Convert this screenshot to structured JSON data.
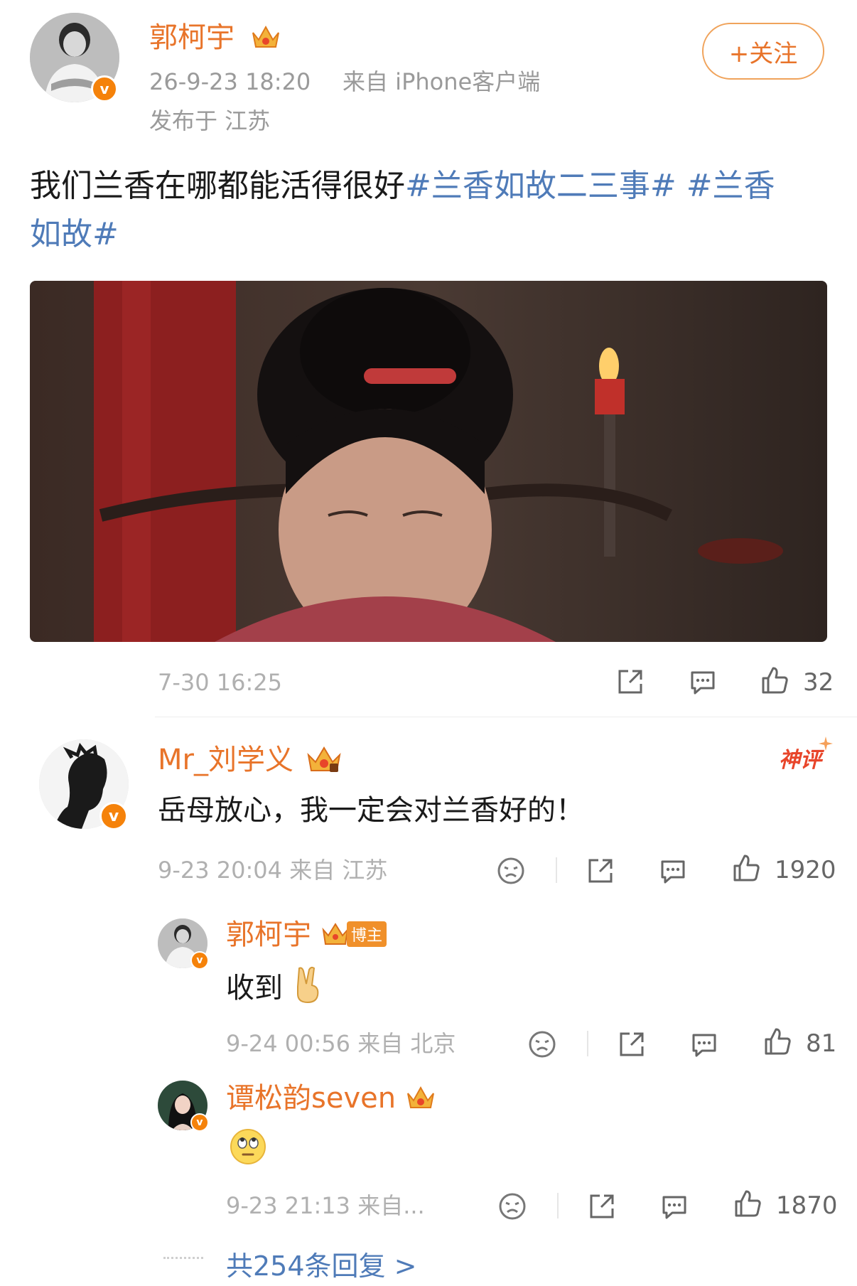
{
  "post": {
    "author": "郭柯宇",
    "time": "26-9-23 18:20",
    "source": "来自 iPhone客户端",
    "location": "发布于 江苏",
    "follow_label": "+关注",
    "text_prefix": "我们兰香在哪都能活得很好",
    "topic1": "#兰香如故二三事#",
    "topic2_part1": "#兰香",
    "topic2_part2": "如故#",
    "stamp": "7-30 16:25",
    "likes": "32"
  },
  "comments": [
    {
      "name": "Mr_刘学义",
      "badge": "神评",
      "text": "岳母放心，我一定会对兰香好的！",
      "meta": "9-23 20:04 来自 江苏",
      "likes": "1920"
    }
  ],
  "replies": [
    {
      "name": "郭柯宇",
      "tag": "博主",
      "text": "收到",
      "meta": "9-24 00:56 来自 北京",
      "likes": "81"
    },
    {
      "name": "谭松韵seven",
      "meta": "9-23 21:13 来自...",
      "likes": "1870"
    }
  ],
  "more_replies": "共254条回复 >",
  "colors": {
    "accent": "#e8742a",
    "topic": "#4f7bb8",
    "meta": "#9a9a9a"
  }
}
